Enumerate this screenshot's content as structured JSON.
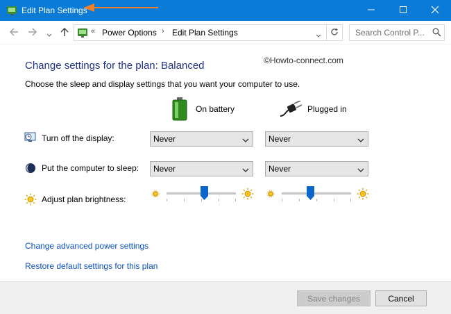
{
  "window": {
    "title": "Edit Plan Settings",
    "controls": [
      "minimize-icon",
      "maximize-icon",
      "close-icon"
    ],
    "accent": "#0a7bd6",
    "annotation_color": "#f07f2a"
  },
  "nav": {
    "back_icon": "back-arrow-icon",
    "forward_icon": "forward-arrow-icon",
    "recent_icon": "chevron-down-icon",
    "up_icon": "up-arrow-icon",
    "address_overflow": "«",
    "breadcrumbs": [
      "Power Options",
      "Edit Plan Settings"
    ],
    "breadcrumb_separator": "›",
    "refresh_icon": "refresh-icon",
    "search_placeholder": "Search Control P..."
  },
  "watermark": "©Howto-connect.com",
  "heading": "Change settings for the plan: Balanced",
  "subheading": "Choose the sleep and display settings that you want your computer to use.",
  "columns": {
    "battery": "On battery",
    "plugged": "Plugged in"
  },
  "settings": [
    {
      "label": "Turn off the display:",
      "battery": "Never",
      "plugged": "Never",
      "icon": "display-icon"
    },
    {
      "label": "Put the computer to sleep:",
      "battery": "Never",
      "plugged": "Never",
      "icon": "sleep-icon"
    }
  ],
  "brightness": {
    "label": "Adjust plan brightness:",
    "icon": "sun-icon",
    "battery_level": 0.55,
    "plugged_level": 0.4
  },
  "links": {
    "advanced": "Change advanced power settings",
    "restore": "Restore default settings for this plan"
  },
  "footer": {
    "save": "Save changes",
    "cancel": "Cancel"
  }
}
